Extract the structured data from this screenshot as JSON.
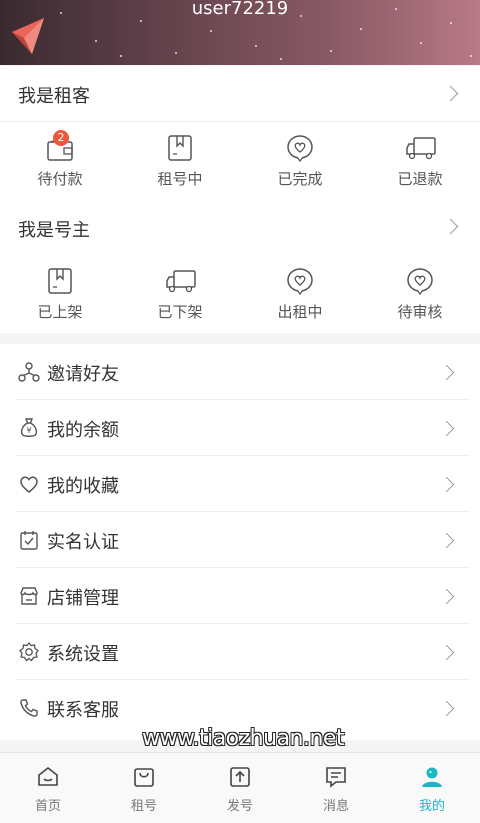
{
  "header": {
    "username": "user72219"
  },
  "tenant": {
    "title": "我是租客",
    "items": [
      {
        "label": "待付款",
        "icon": "wallet-icon",
        "badge": "2"
      },
      {
        "label": "租号中",
        "icon": "bookmark-icon"
      },
      {
        "label": "已完成",
        "icon": "heart-bubble-icon"
      },
      {
        "label": "已退款",
        "icon": "truck-icon"
      }
    ]
  },
  "owner": {
    "title": "我是号主",
    "items": [
      {
        "label": "已上架",
        "icon": "bookmark-icon"
      },
      {
        "label": "已下架",
        "icon": "truck-icon"
      },
      {
        "label": "出租中",
        "icon": "heart-bubble-icon"
      },
      {
        "label": "待审核",
        "icon": "heart-bubble-icon"
      }
    ]
  },
  "menu": [
    {
      "label": "邀请好友",
      "icon": "share-network-icon"
    },
    {
      "label": "我的余额",
      "icon": "money-bag-icon"
    },
    {
      "label": "我的收藏",
      "icon": "heart-icon"
    },
    {
      "label": "实名认证",
      "icon": "calendar-check-icon"
    },
    {
      "label": "店铺管理",
      "icon": "store-icon"
    },
    {
      "label": "系统设置",
      "icon": "gear-icon"
    },
    {
      "label": "联系客服",
      "icon": "phone-icon"
    }
  ],
  "tabbar": [
    {
      "label": "首页",
      "icon": "home-icon",
      "active": false
    },
    {
      "label": "租号",
      "icon": "bag-icon",
      "active": false
    },
    {
      "label": "发号",
      "icon": "upload-icon",
      "active": false
    },
    {
      "label": "消息",
      "icon": "message-icon",
      "active": false
    },
    {
      "label": "我的",
      "icon": "user-icon",
      "active": true
    }
  ],
  "watermark": "www.tiaozhuan.net",
  "colors": {
    "accent": "#1fb6c4",
    "badge": "#f0563c"
  }
}
